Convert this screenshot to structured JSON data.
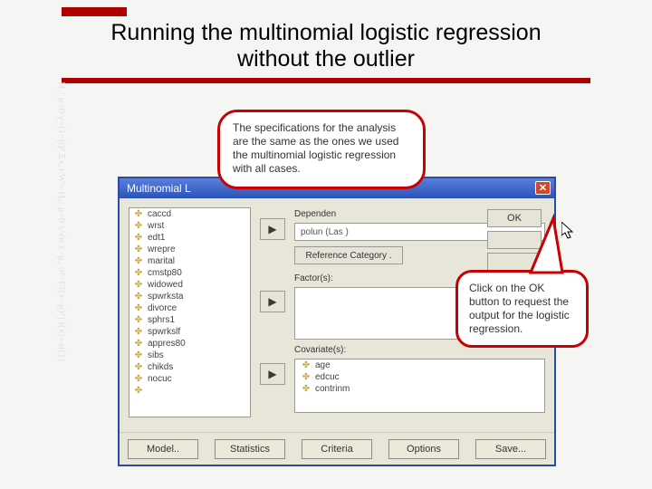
{
  "slide": {
    "title_line1": "Running the multinomial logistic regression",
    "title_line2": "without the outlier"
  },
  "callouts": {
    "spec": "The specifications for the analysis are the same as the ones we used the multinomial logistic regression with all cases.",
    "ok": "Click on the OK button to request the output for the logistic regression."
  },
  "dialog": {
    "title": "Multinomial L",
    "dependent_label": "Dependen",
    "dependent_value": "polun (Las )",
    "refcat_label": "Reference Category .",
    "factors_label": "Factor(s):",
    "covariates_label": "Covariate(s):",
    "variables": [
      "caccd",
      "wrst",
      "edt1",
      "wrepre",
      "marital",
      "cmstp80",
      "widowed",
      "spwrksta",
      "divorce",
      "sphrs1",
      "spwrkslf",
      "appres80",
      "sibs",
      "chikds",
      "nocuc",
      ""
    ],
    "covariates": [
      "age",
      "edcuc",
      "contrinm"
    ],
    "rhs_buttons": [
      "OK",
      "",
      "",
      "",
      ""
    ],
    "bottom_buttons": [
      "Model..",
      "Statistics",
      "Criteria",
      "Options",
      "Save..."
    ]
  },
  "bg_math": "H₁: μ<0 γ=(1−β)² Σxᵢ t W= H₀: μ=0 s/√n x̄−μ₀ σ²=E[(x−μ)²] f(x)+af(1)"
}
